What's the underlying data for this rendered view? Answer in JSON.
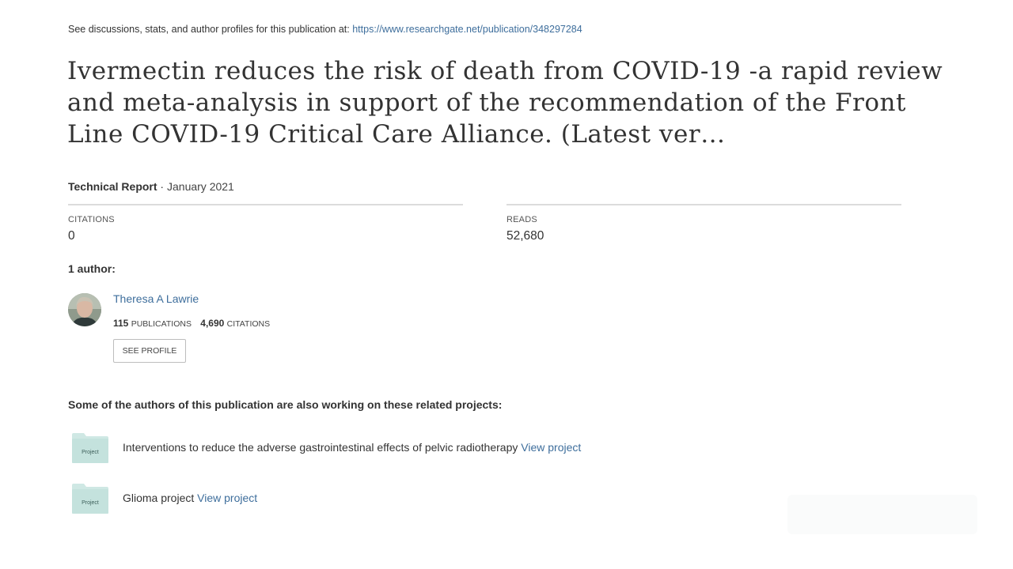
{
  "header": {
    "prefix": "See discussions, stats, and author profiles for this publication at: ",
    "url": "https://www.researchgate.net/publication/348297284"
  },
  "title": "Ivermectin reduces the risk of death from COVID-19 -a rapid review and meta-analysis in support of the recommendation of the Front Line COVID-19 Critical Care Alliance. (Latest ver…",
  "meta": {
    "type": "Technical Report",
    "separator": " · ",
    "date": "January 2021"
  },
  "stats": {
    "citations_label": "CITATIONS",
    "citations_value": "0",
    "reads_label": "READS",
    "reads_value": "52,680"
  },
  "authors": {
    "heading": "1 author:",
    "list": [
      {
        "name": "Theresa A Lawrie",
        "publications_count": "115",
        "publications_label": "PUBLICATIONS",
        "citations_count": "4,690",
        "citations_label": "CITATIONS",
        "profile_button": "SEE PROFILE"
      }
    ]
  },
  "projects": {
    "heading": "Some of the authors of this publication are also working on these related projects:",
    "folder_label": "Project",
    "items": [
      {
        "name": "Interventions to reduce the adverse gastrointestinal effects of pelvic radiotherapy",
        "link": "View project"
      },
      {
        "name": "Glioma project",
        "link": "View project"
      }
    ]
  },
  "colors": {
    "link": "#3e6e9c",
    "folder": "#cfe8e4",
    "divider": "#dcdcdc"
  }
}
